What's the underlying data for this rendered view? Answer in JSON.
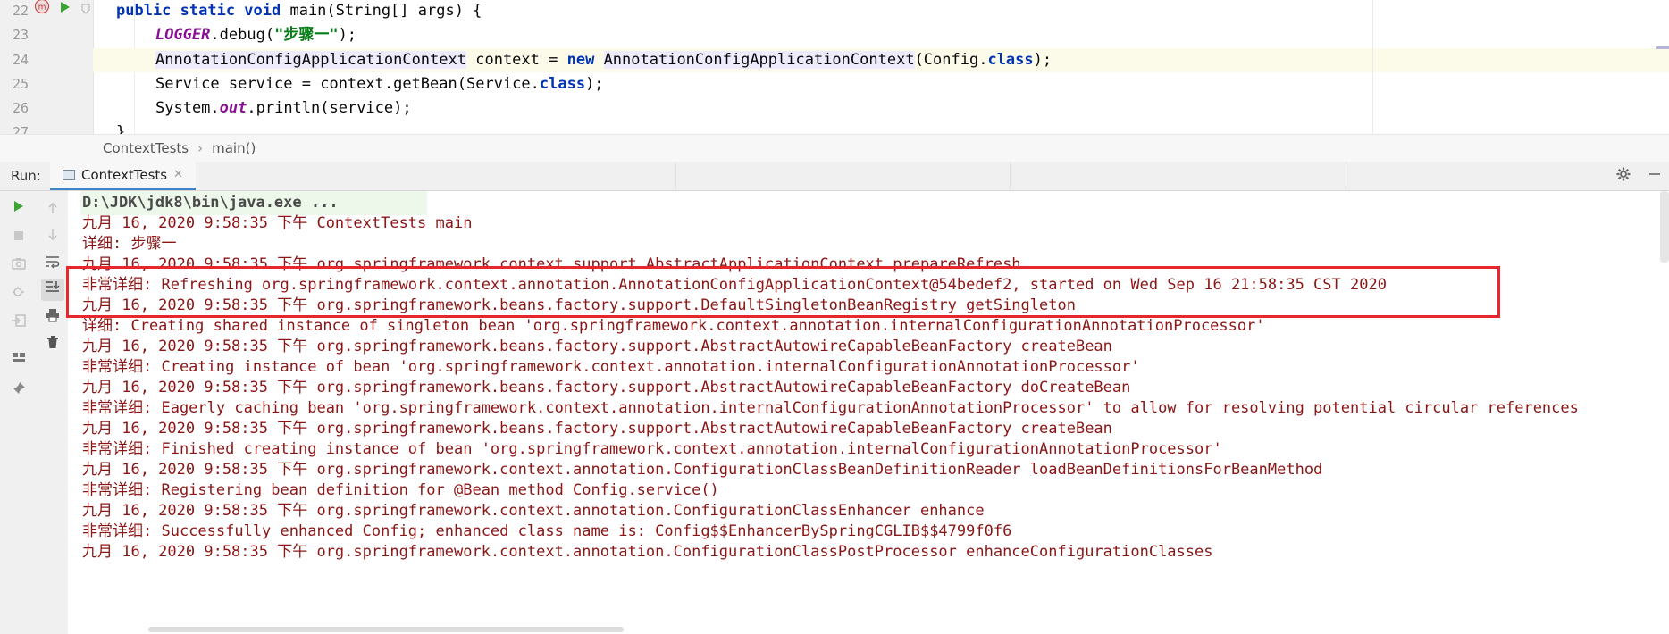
{
  "editor": {
    "line_numbers": [
      "22",
      "23",
      "24",
      "25",
      "26",
      "27"
    ],
    "lines": {
      "l22": {
        "kw": "public static void",
        "rest": " main(String[] args) {"
      },
      "l23": {
        "field": "LOGGER",
        "call": ".debug(",
        "str": "\"步骤一\"",
        "end": ");"
      },
      "l24": {
        "type1": "AnnotationConfigApplicationContext",
        "mid": " context = ",
        "kw": "new",
        "sp": " ",
        "type2": "AnnotationConfigApplicationContext",
        "arg": "(Config.",
        "kw2": "class",
        "end": ");"
      },
      "l25": {
        "a": "Service service = context.getBean(Service.",
        "kw": "class",
        "end": ");"
      },
      "l26": {
        "a": "System.",
        "field": "out",
        "end": ".println(service);"
      },
      "l27": {
        "a": "}"
      }
    }
  },
  "breadcrumb": {
    "items": [
      "ContextTests",
      "main()"
    ],
    "separator": "›"
  },
  "run_panel": {
    "label": "Run:",
    "tab": {
      "label": "ContextTests",
      "close": "✕"
    },
    "settings_icon": "gear-icon",
    "minimize_icon": "minimize-icon"
  },
  "toolbar": {
    "icons": [
      "rerun-icon",
      "stop-icon",
      "camera-icon",
      "settings-bug-icon",
      "login-icon",
      "layout-icon",
      "pin-icon"
    ],
    "icons2": [
      "up-arrow-icon",
      "down-arrow-icon",
      "soft-wrap-icon",
      "scroll-to-end-icon",
      "print-icon",
      "trash-icon"
    ]
  },
  "console": {
    "lines": [
      "D:\\JDK\\jdk8\\bin\\java.exe ...",
      "九月 16, 2020 9:58:35 下午 ContextTests main",
      "详细: 步骤一",
      "九月 16, 2020 9:58:35 下午 org.springframework.context.support.AbstractApplicationContext prepareRefresh",
      "非常详细: Refreshing org.springframework.context.annotation.AnnotationConfigApplicationContext@54bedef2, started on Wed Sep 16 21:58:35 CST 2020",
      "九月 16, 2020 9:58:35 下午 org.springframework.beans.factory.support.DefaultSingletonBeanRegistry getSingleton",
      "详细: Creating shared instance of singleton bean 'org.springframework.context.annotation.internalConfigurationAnnotationProcessor'",
      "九月 16, 2020 9:58:35 下午 org.springframework.beans.factory.support.AbstractAutowireCapableBeanFactory createBean",
      "非常详细: Creating instance of bean 'org.springframework.context.annotation.internalConfigurationAnnotationProcessor'",
      "九月 16, 2020 9:58:35 下午 org.springframework.beans.factory.support.AbstractAutowireCapableBeanFactory doCreateBean",
      "非常详细: Eagerly caching bean 'org.springframework.context.annotation.internalConfigurationAnnotationProcessor' to allow for resolving potential circular references",
      "九月 16, 2020 9:58:35 下午 org.springframework.beans.factory.support.AbstractAutowireCapableBeanFactory createBean",
      "非常详细: Finished creating instance of bean 'org.springframework.context.annotation.internalConfigurationAnnotationProcessor'",
      "九月 16, 2020 9:58:35 下午 org.springframework.context.annotation.ConfigurationClassBeanDefinitionReader loadBeanDefinitionsForBeanMethod",
      "非常详细: Registering bean definition for @Bean method Config.service()",
      "九月 16, 2020 9:58:35 下午 org.springframework.context.annotation.ConfigurationClassEnhancer enhance",
      "非常详细: Successfully enhanced Config; enhanced class name is: Config$$EnhancerBySpringCGLIB$$4799f0f6",
      "九月 16, 2020 9:58:35 下午 org.springframework.context.annotation.ConfigurationClassPostProcessor enhanceConfigurationClasses"
    ]
  },
  "colors": {
    "console_text": "#8b1616",
    "keyword": "#0033b3",
    "string": "#067d17",
    "field": "#871094",
    "highlight_box": "#e8262d",
    "run_icon": "#3ea335"
  }
}
